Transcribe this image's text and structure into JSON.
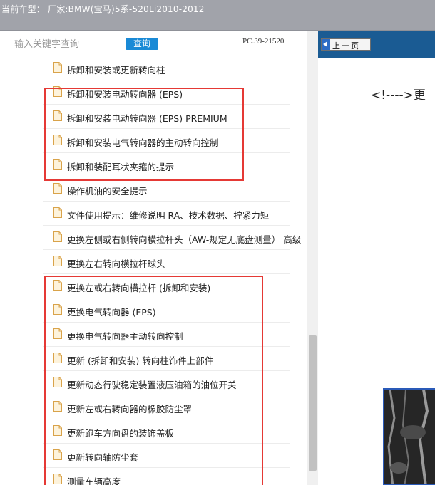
{
  "header": {
    "current_model": "当前车型：  厂家:BMW(宝马)5系-520Li2010-2012"
  },
  "search": {
    "placeholder": "输入关键字查询",
    "button_label": "查询",
    "part_number": "PC.39-21520"
  },
  "items": [
    "拆卸和安装或更新转向柱",
    "拆卸和安装电动转向器 (EPS)",
    "拆卸和安装电动转向器 (EPS) PREMIUM",
    "拆卸和安装电气转向器的主动转向控制",
    "拆卸和装配耳状夹箍的提示",
    "操作机油的安全提示",
    "文件使用提示：维修说明 RA、技术数据、拧紧力矩",
    "更换左侧或右侧转向横拉杆头（AW-规定无底盘测量） 高级",
    "更换左右转向横拉杆球头",
    "更换左或右转向横拉杆 (拆卸和安装)",
    "更换电气转向器 (EPS)",
    "更换电气转向器主动转向控制",
    "更新 (拆卸和安装) 转向柱饰件上部件",
    "更新动态行驶稳定装置液压油箱的油位开关",
    "更新左或右转向器的橡胶防尘罩",
    "更新跑车方向盘的装饰盖板",
    "更新转向轴防尘套",
    "测量车辆高度"
  ],
  "viewer": {
    "prev_page_label": "上一页",
    "content_text": "<!---->更"
  },
  "colors": {
    "header_bg": "#a1a3aa",
    "search_button": "#1a8ad6",
    "highlight": "#e53935",
    "viewer_toolbar": "#1a5b93"
  },
  "icons": {
    "list_item": "document-icon",
    "prev_page": "arrow-left-icon"
  }
}
